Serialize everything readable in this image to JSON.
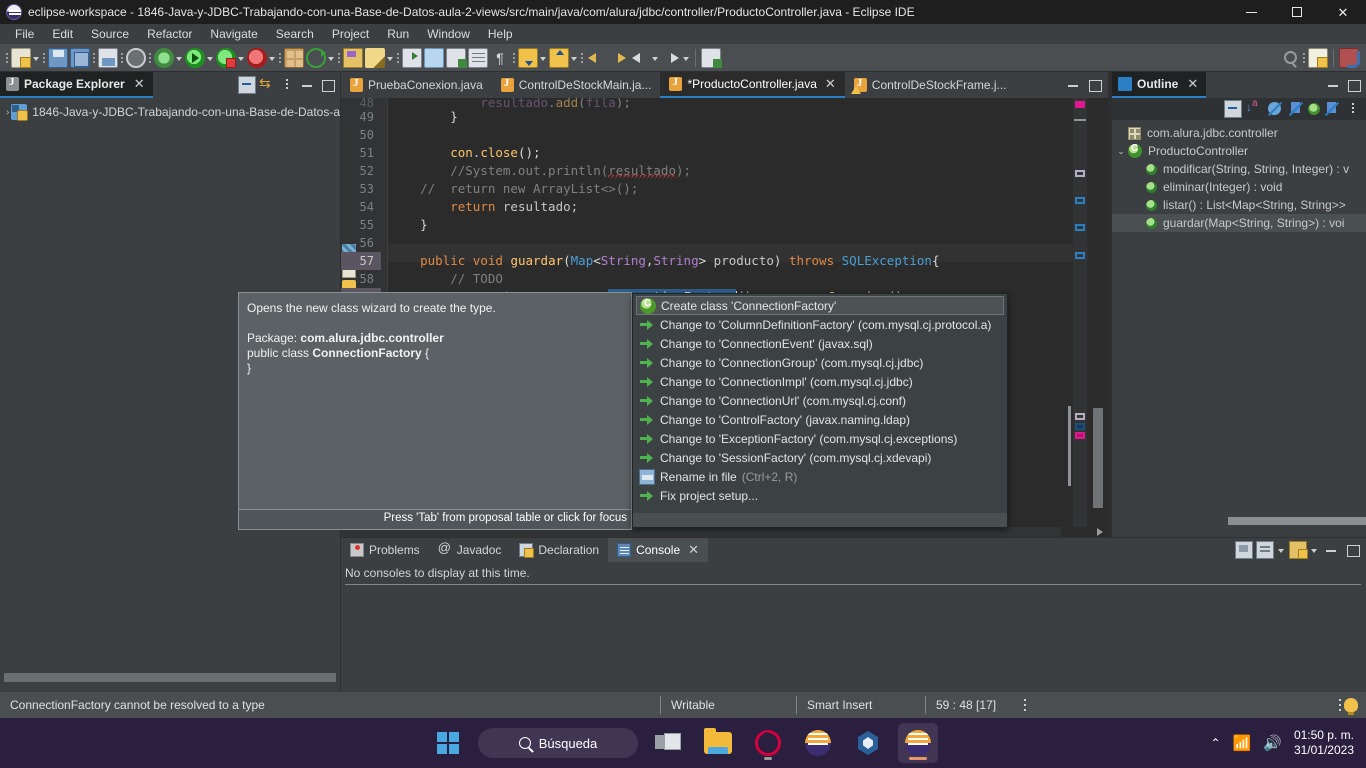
{
  "window": {
    "title": "eclipse-workspace - 1846-Java-y-JDBC-Trabajando-con-una-Base-de-Datos-aula-2-views/src/main/java/com/alura/jdbc/controller/ProductoController.java - Eclipse IDE",
    "minimize_label": "Minimize",
    "restore_label": "Restore",
    "close_label": "Close"
  },
  "menubar": {
    "items": [
      {
        "label": "File"
      },
      {
        "label": "Edit"
      },
      {
        "label": "Source"
      },
      {
        "label": "Refactor"
      },
      {
        "label": "Navigate"
      },
      {
        "label": "Search"
      },
      {
        "label": "Project"
      },
      {
        "label": "Run"
      },
      {
        "label": "Window"
      },
      {
        "label": "Help"
      }
    ]
  },
  "package_explorer": {
    "tab_label": "Package Explorer",
    "close_label": "✕",
    "tools": [
      {
        "name": "collapse-all"
      },
      {
        "name": "link-with-editor"
      },
      {
        "name": "view-menu"
      },
      {
        "name": "minimize"
      },
      {
        "name": "maximize"
      }
    ],
    "tree": [
      {
        "label": "1846-Java-y-JDBC-Trabajando-con-una-Base-de-Datos-a",
        "arrow": "›"
      }
    ]
  },
  "editor": {
    "tabs": [
      {
        "label": "PruebaConexion.java",
        "active": false,
        "dirty": false,
        "warning": false
      },
      {
        "label": "ControlDeStockMain.ja...",
        "active": false,
        "dirty": false,
        "warning": false
      },
      {
        "label": "*ProductoController.java",
        "active": true,
        "dirty": true,
        "warning": false,
        "close": "✕"
      },
      {
        "label": "ControlDeStockFrame.j...",
        "active": false,
        "dirty": false,
        "warning": true
      }
    ],
    "lines": [
      {
        "num": "48",
        "partial": true,
        "text": "            resultado.add(fila);"
      },
      {
        "num": "49",
        "text": "        }"
      },
      {
        "num": "50",
        "text": ""
      },
      {
        "num": "51",
        "text": "        con.close();"
      },
      {
        "num": "52",
        "text": "        //System.out.println(resultado);"
      },
      {
        "num": "53",
        "text": "    //  return new ArrayList<>();"
      },
      {
        "num": "54",
        "text": "        return resultado;"
      },
      {
        "num": "55",
        "text": "    }"
      },
      {
        "num": "56",
        "text": ""
      },
      {
        "num": "57",
        "text": "    public void guardar(Map<String,String> producto) throws SQLException{",
        "highlighted": true
      },
      {
        "num": "58",
        "text": "        // TODO"
      },
      {
        "num": "59",
        "text": "        Connection con = new ConnectionFactory().recuperarConexion();",
        "highlighted": true
      }
    ],
    "selected_token": "ConnectionFactory"
  },
  "javadoc_hover": {
    "line1": "Opens the new class wizard to create the type.",
    "package_label": "Package:",
    "package_value": "com.alura.jdbc.controller",
    "decl_prefix": "public class ",
    "decl_name": "ConnectionFactory",
    "decl_suffix": " {",
    "decl_close": "}",
    "footer": "Press 'Tab' from proposal table or click for focus"
  },
  "proposals": {
    "items": [
      {
        "text": "Create class 'ConnectionFactory'",
        "icon": "class-icon",
        "selected": true,
        "dim": ""
      },
      {
        "text": "Change to 'ColumnDefinitionFactory' (com.mysql.cj.protocol.a)",
        "icon": "change-icon",
        "selected": false,
        "dim": ""
      },
      {
        "text": "Change to 'ConnectionEvent' (javax.sql)",
        "icon": "change-icon",
        "selected": false,
        "dim": ""
      },
      {
        "text": "Change to 'ConnectionGroup' (com.mysql.cj.jdbc)",
        "icon": "change-icon",
        "selected": false,
        "dim": ""
      },
      {
        "text": "Change to 'ConnectionImpl' (com.mysql.cj.jdbc)",
        "icon": "change-icon",
        "selected": false,
        "dim": ""
      },
      {
        "text": "Change to 'ConnectionUrl' (com.mysql.cj.conf)",
        "icon": "change-icon",
        "selected": false,
        "dim": ""
      },
      {
        "text": "Change to 'ControlFactory' (javax.naming.ldap)",
        "icon": "change-icon",
        "selected": false,
        "dim": ""
      },
      {
        "text": "Change to 'ExceptionFactory' (com.mysql.cj.exceptions)",
        "icon": "change-icon",
        "selected": false,
        "dim": ""
      },
      {
        "text": "Change to 'SessionFactory' (com.mysql.cj.xdevapi)",
        "icon": "change-icon",
        "selected": false,
        "dim": ""
      },
      {
        "text": "Rename in file",
        "icon": "rename-icon",
        "selected": false,
        "dim": "(Ctrl+2, R)"
      },
      {
        "text": "Fix project setup...",
        "icon": "change-icon",
        "selected": false,
        "dim": ""
      }
    ]
  },
  "outline": {
    "tab_label": "Outline",
    "close_label": "✕",
    "tools": [
      {
        "name": "collapse-all"
      },
      {
        "name": "sort"
      },
      {
        "name": "hide-fields"
      },
      {
        "name": "hide-static"
      },
      {
        "name": "public-only"
      },
      {
        "name": "hide-non-public"
      },
      {
        "name": "view-menu"
      }
    ],
    "items": [
      {
        "label": "com.alura.jdbc.controller",
        "icon": "package-icon",
        "indent": 1,
        "arrow": ""
      },
      {
        "label": "ProductoController",
        "icon": "class-icon",
        "indent": 0,
        "arrow": "⌄"
      },
      {
        "label": "modificar(String, String, Integer) : v",
        "icon": "method-icon",
        "indent": 2,
        "arrow": ""
      },
      {
        "label": "eliminar(Integer) : void",
        "icon": "method-icon",
        "indent": 2,
        "arrow": ""
      },
      {
        "label": "listar() : List<Map<String, String>>",
        "icon": "method-icon",
        "indent": 2,
        "arrow": ""
      },
      {
        "label": "guardar(Map<String, String>) : voi",
        "icon": "method-icon",
        "indent": 2,
        "arrow": "",
        "selected": true
      }
    ]
  },
  "console": {
    "tabs": [
      {
        "label": "Problems",
        "icon": "problems-icon",
        "active": false
      },
      {
        "label": "Javadoc",
        "icon": "javadoc-icon",
        "active": false
      },
      {
        "label": "Declaration",
        "icon": "declaration-icon",
        "active": false
      },
      {
        "label": "Console",
        "icon": "console-icon",
        "active": true,
        "close": "✕"
      }
    ],
    "message": "No consoles to display at this time."
  },
  "statusbar": {
    "message": "ConnectionFactory cannot be resolved to a type",
    "writable": "Writable",
    "insert_mode": "Smart Insert",
    "position": "59 : 48 [17]"
  },
  "taskbar": {
    "start_label": "Start",
    "search_placeholder": "Búsqueda",
    "items": [
      {
        "name": "task-view"
      },
      {
        "name": "file-explorer"
      },
      {
        "name": "opera-browser"
      },
      {
        "name": "eclipse-installer"
      },
      {
        "name": "virtualbox"
      },
      {
        "name": "eclipse-ide"
      }
    ],
    "clock_time": "01:50 p. m.",
    "clock_date": "31/01/2023"
  },
  "colors": {
    "accent": "#2b7fc4",
    "editor_bg": "#2b2b2b",
    "panel_bg": "#3c3f41",
    "error": "#d04a8a"
  }
}
